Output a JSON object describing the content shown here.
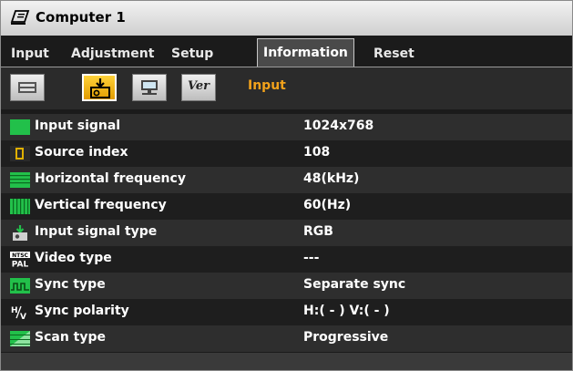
{
  "window": {
    "title": "Computer 1",
    "title_icon": "computer-input-icon"
  },
  "tabs": [
    {
      "label": "Input",
      "active": false
    },
    {
      "label": "Adjustment",
      "active": false
    },
    {
      "label": "Setup",
      "active": false
    },
    {
      "label": "Information",
      "active": true
    },
    {
      "label": "Reset",
      "active": false
    }
  ],
  "subtabs": {
    "buttons": [
      {
        "icon": "usage-time-icon",
        "active": false
      },
      {
        "icon": "input-source-icon",
        "active": true
      },
      {
        "icon": "wired-lan-icon",
        "active": false
      },
      {
        "icon": "version-icon",
        "text": "Ver",
        "active": false
      }
    ],
    "current_label": "Input"
  },
  "info_rows": [
    {
      "icon": "input-signal-icon",
      "label": "Input signal",
      "value": "1024x768"
    },
    {
      "icon": "source-index-icon",
      "label": "Source index",
      "value": "108"
    },
    {
      "icon": "horizontal-frequency-icon",
      "label": "Horizontal frequency",
      "value": "48(kHz)"
    },
    {
      "icon": "vertical-frequency-icon",
      "label": "Vertical frequency",
      "value": "60(Hz)"
    },
    {
      "icon": "input-signal-type-icon",
      "label": "Input signal type",
      "value": "RGB"
    },
    {
      "icon": "video-type-icon",
      "label": "Video type",
      "value": "---"
    },
    {
      "icon": "sync-type-icon",
      "label": "Sync type",
      "value": "Separate sync"
    },
    {
      "icon": "sync-polarity-icon",
      "label": "Sync polarity",
      "value": "H:( - ) V:( - )"
    },
    {
      "icon": "scan-type-icon",
      "label": "Scan type",
      "value": "Progressive"
    }
  ],
  "colors": {
    "accent_label": "#f2a21b",
    "icon_green": "#22c04a",
    "active_subtab": "#f5b800"
  }
}
